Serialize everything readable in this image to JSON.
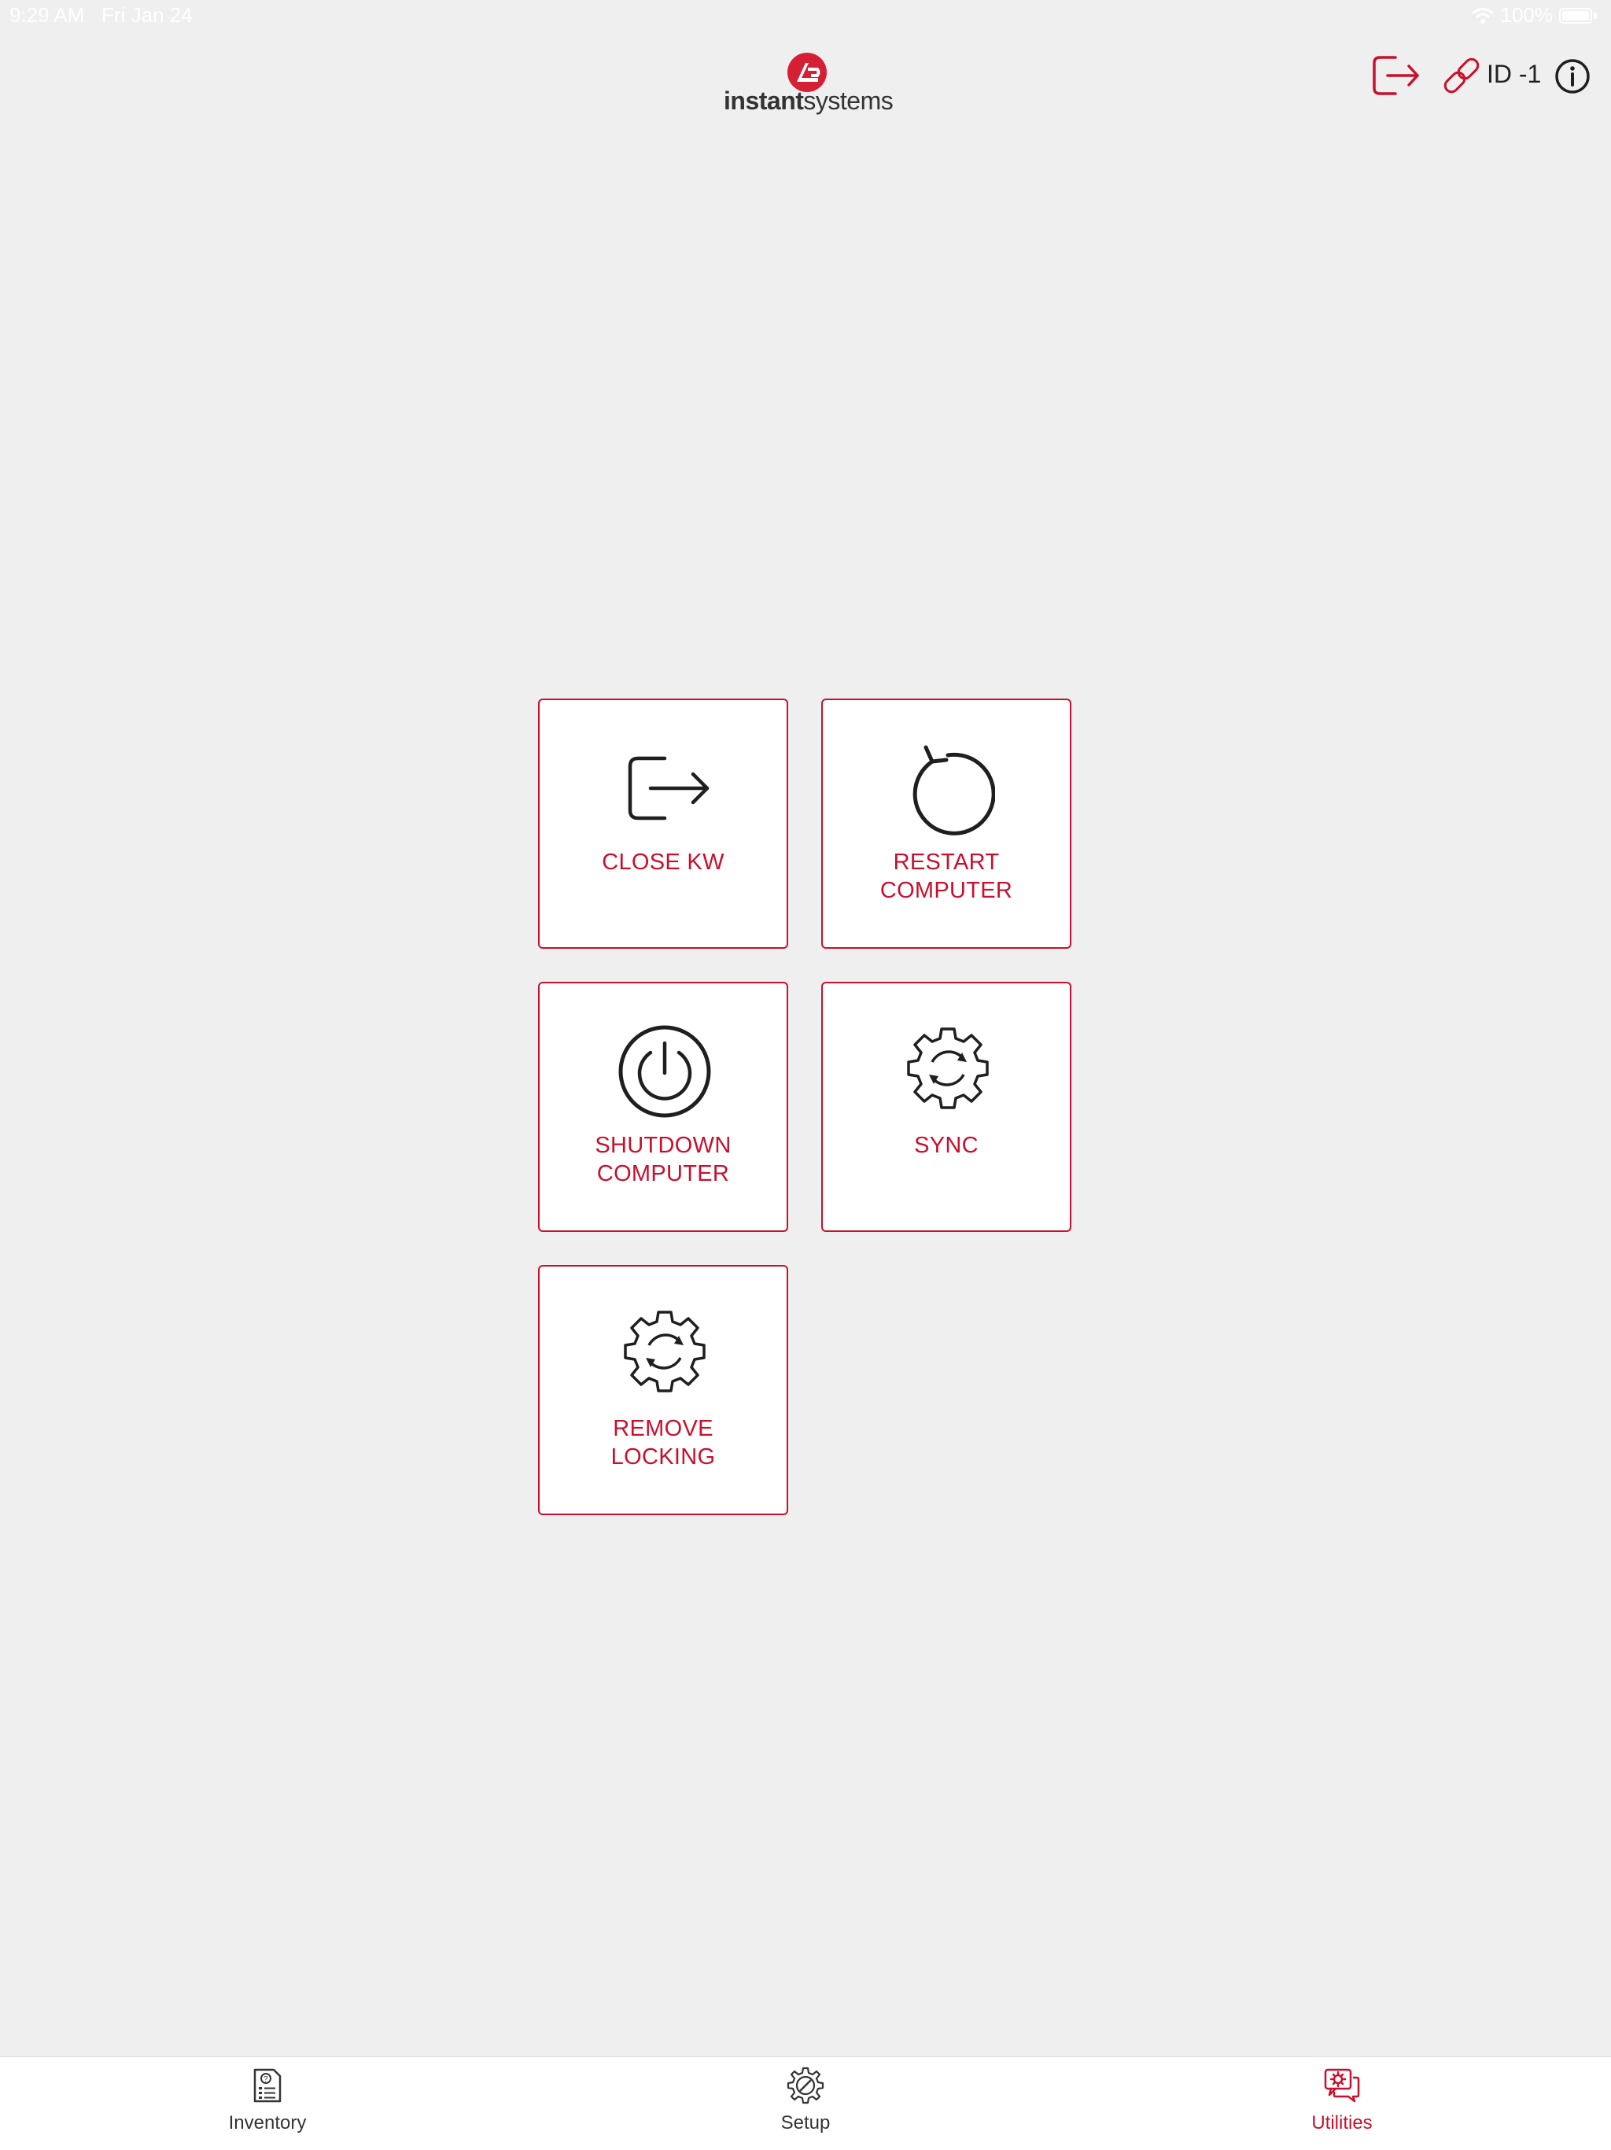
{
  "status_bar": {
    "time": "9:29 AM   Fri Jan 24",
    "battery": "100%"
  },
  "header": {
    "logo_bold": "instant",
    "logo_light": "systems",
    "id_label": "ID -1",
    "icons": [
      "exit-icon",
      "link-icon",
      "info-icon"
    ]
  },
  "tiles": [
    {
      "label": "CLOSE KW",
      "icon": "exit-icon"
    },
    {
      "label": "RESTART\nCOMPUTER",
      "icon": "restart-icon"
    },
    {
      "label": "SHUTDOWN\nCOMPUTER",
      "icon": "power-icon"
    },
    {
      "label": "SYNC",
      "icon": "sync-gear-icon"
    },
    {
      "label": "REMOVE\nLOCKING",
      "icon": "sync-gear-icon"
    }
  ],
  "tab_bar": {
    "tabs": [
      {
        "label": "Inventory",
        "icon": "inventory-icon",
        "active": false
      },
      {
        "label": "Setup",
        "icon": "setup-gear-icon",
        "active": false
      },
      {
        "label": "Utilities",
        "icon": "utilities-icon",
        "active": true
      }
    ]
  },
  "colors": {
    "accent": "#c8102e",
    "background": "#efefef",
    "tile_background": "#ffffff",
    "icon_dark": "#1f1f1f"
  }
}
